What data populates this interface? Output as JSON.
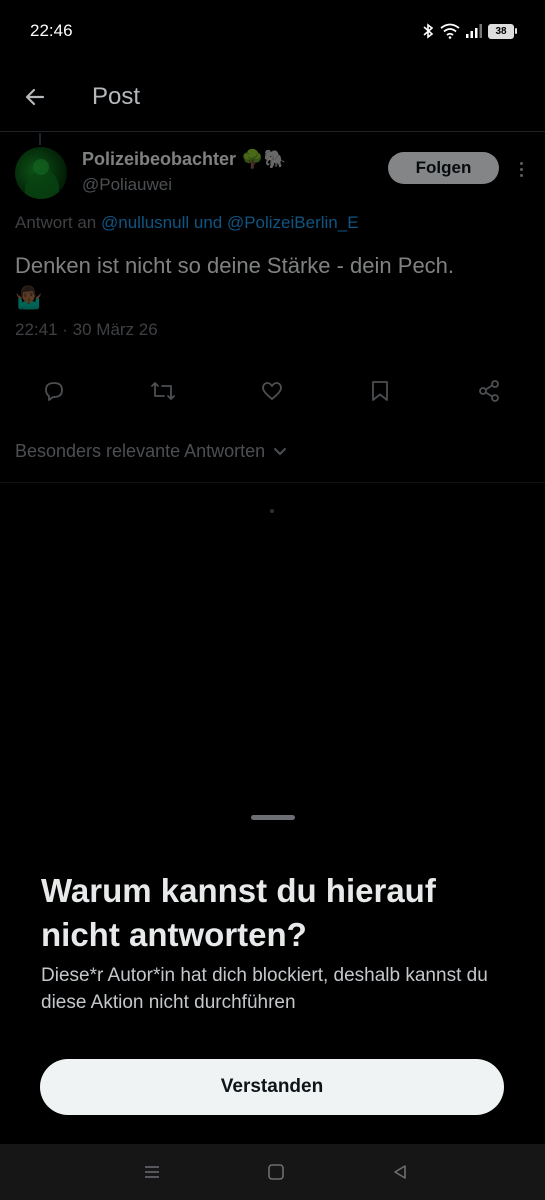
{
  "status_bar": {
    "time": "22:46",
    "battery": "38",
    "icons": [
      "bluetooth-icon",
      "wifi-icon",
      "signal-icon",
      "battery-icon"
    ]
  },
  "header": {
    "title": "Post",
    "back_icon": "arrow-left-icon"
  },
  "post": {
    "author_name": "Polizeibeobachter",
    "author_emojis": "🌳🐘",
    "author_handle": "@Poliauwei",
    "follow_label": "Folgen",
    "reply_prefix": "Antwort an ",
    "reply_mentions": "@nullusnull und @PolizeiBerlin_E",
    "text": "Denken ist nicht so deine Stärke - dein Pech.",
    "emoji": "🤷🏾‍♂️",
    "timestamp": "22:41 · 30 März 26",
    "actions": [
      "reply-icon",
      "repost-icon",
      "like-icon",
      "bookmark-icon",
      "share-icon"
    ]
  },
  "replies": {
    "sort_label": "Besonders relevante Antworten"
  },
  "sheet": {
    "title": "Warum kannst du hierauf nicht antworten?",
    "description": "Diese*r Autor*in hat dich blockiert, deshalb kannst du diese Aktion nicht durchführen",
    "button_label": "Verstanden"
  },
  "colors": {
    "accent": "#1d9bf0",
    "background": "#000000",
    "button": "#eff3f4"
  }
}
